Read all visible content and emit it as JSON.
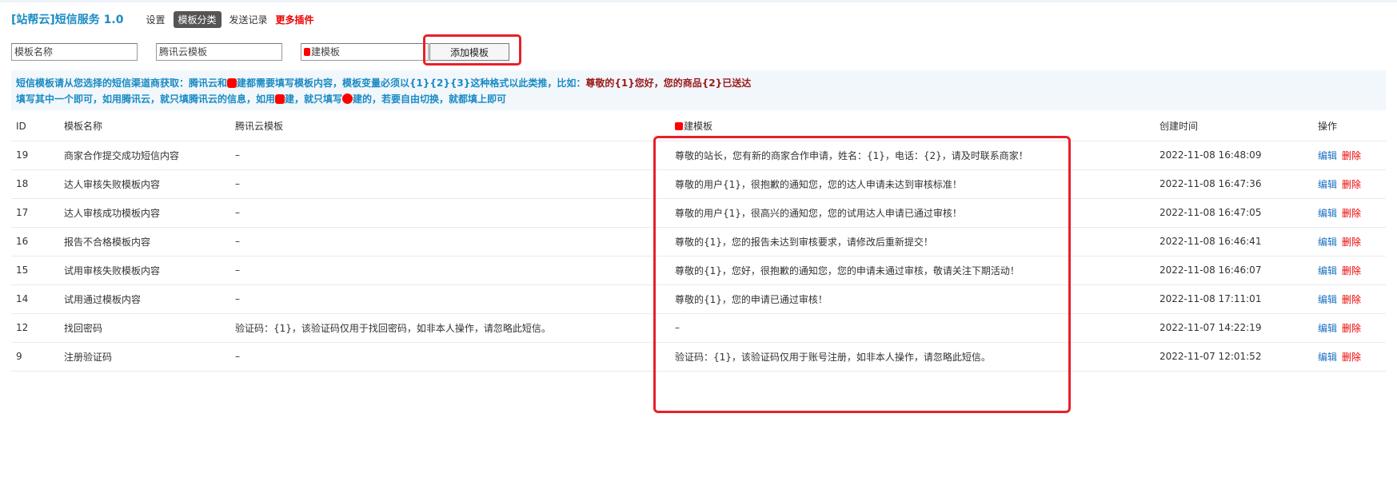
{
  "header": {
    "brand": "[站帮云]短信服务 1.0",
    "nav": [
      {
        "label": "设置",
        "active": false
      },
      {
        "label": "模板分类",
        "active": true
      },
      {
        "label": "发送记录",
        "active": false
      },
      {
        "label": "更多插件",
        "active": false
      }
    ]
  },
  "form": {
    "name_placeholder": "模板名称",
    "tencent_placeholder": "腾讯云模板",
    "sd_placeholder": "建模板",
    "add_label": "添加模板"
  },
  "notice": {
    "l1_a": "短信模板请从您选择的短信渠道商获取：腾讯云和",
    "l1_b": "建都需要填写模板内容，模板变量必须以{1}{2}{3}这种格式以此类推，比如：",
    "l1_example": "尊敬的{1}您好，您的商品{2}已送达",
    "l2_a": "填写其中一个即可，如用腾讯云，就只填腾讯云的信息，如用",
    "l2_b": "建，就只填写",
    "l2_c": "建的，若要自由切换，就都填上即可"
  },
  "table": {
    "headers": {
      "id": "ID",
      "name": "模板名称",
      "tencent": "腾讯云模板",
      "sd": "建模板",
      "created": "创建时间",
      "actions": "操作"
    },
    "edit_label": "编辑",
    "delete_label": "删除",
    "rows": [
      {
        "id": "19",
        "name": "商家合作提交成功短信内容",
        "tencent": "–",
        "sd": "尊敬的站长，您有新的商家合作申请，姓名：{1}，电话：{2}，请及时联系商家！",
        "created": "2022-11-08 16:48:09"
      },
      {
        "id": "18",
        "name": "达人审核失败模板内容",
        "tencent": "–",
        "sd": "尊敬的用户{1}，很抱歉的通知您，您的达人申请未达到审核标准！",
        "created": "2022-11-08 16:47:36"
      },
      {
        "id": "17",
        "name": "达人审核成功模板内容",
        "tencent": "–",
        "sd": "尊敬的用户{1}，很高兴的通知您，您的试用达人申请已通过审核！",
        "created": "2022-11-08 16:47:05"
      },
      {
        "id": "16",
        "name": "报告不合格模板内容",
        "tencent": "–",
        "sd": "尊敬的{1}，您的报告未达到审核要求，请修改后重新提交！",
        "created": "2022-11-08 16:46:41"
      },
      {
        "id": "15",
        "name": "试用审核失败模板内容",
        "tencent": "–",
        "sd": "尊敬的{1}，您好，很抱歉的通知您，您的申请未通过审核，敬请关注下期活动！",
        "created": "2022-11-08 16:46:07"
      },
      {
        "id": "14",
        "name": "试用通过模板内容",
        "tencent": "–",
        "sd": "尊敬的{1}，您的申请已通过审核！",
        "created": "2022-11-08 17:11:01"
      },
      {
        "id": "12",
        "name": "找回密码",
        "tencent": "验证码：{1}，该验证码仅用于找回密码，如非本人操作，请忽略此短信。",
        "sd": "–",
        "created": "2022-11-07 14:22:19"
      },
      {
        "id": "9",
        "name": "注册验证码",
        "tencent": "–",
        "sd": "验证码：{1}，该验证码仅用于账号注册，如非本人操作，请忽略此短信。",
        "created": "2022-11-07 12:01:52"
      }
    ]
  }
}
